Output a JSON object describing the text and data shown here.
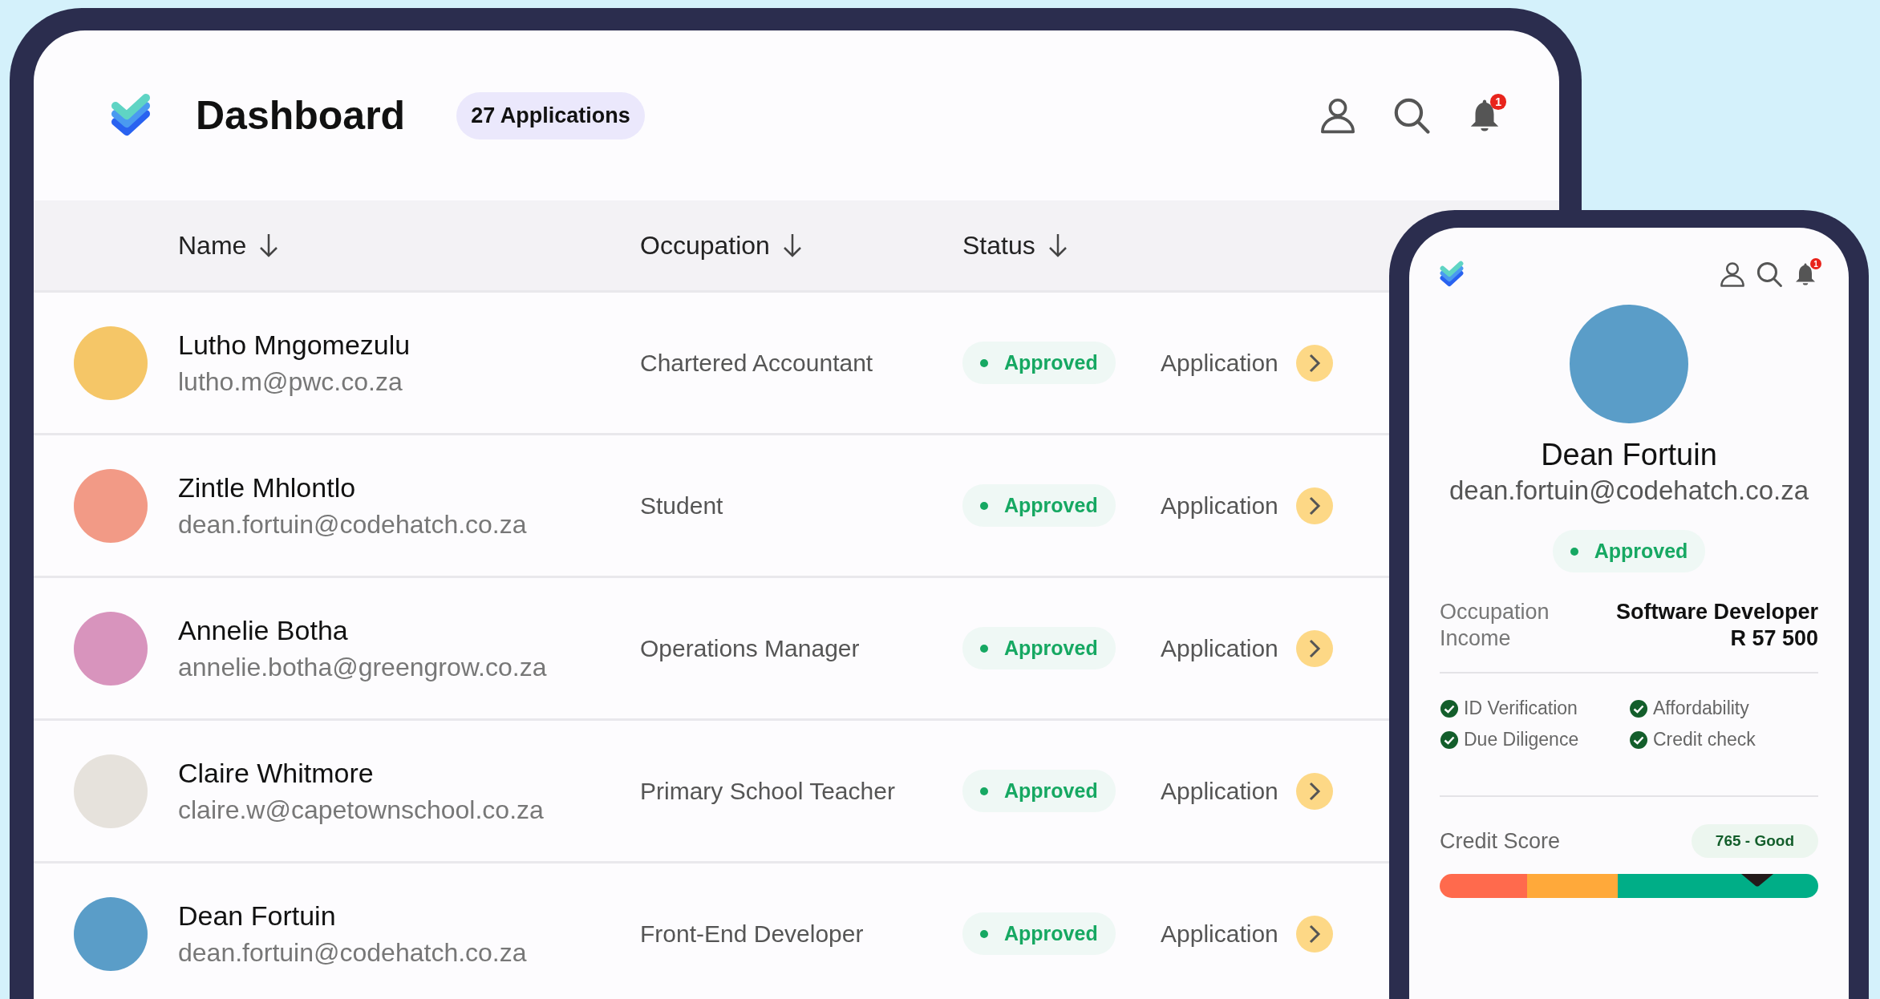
{
  "header": {
    "title": "Dashboard",
    "count_badge": "27 Applications",
    "notification_count": "1"
  },
  "table": {
    "columns": [
      {
        "label": "Name"
      },
      {
        "label": "Occupation"
      },
      {
        "label": "Status"
      }
    ],
    "rows": [
      {
        "name": "Lutho Mngomezulu",
        "email": "lutho.m@pwc.co.za",
        "occupation": "Chartered Accountant",
        "status": "Approved",
        "action": "Application",
        "color": "#f5c667"
      },
      {
        "name": "Zintle Mhlontlo",
        "email": "dean.fortuin@codehatch.co.za",
        "occupation": "Student",
        "status": "Approved",
        "action": "Application",
        "color": "#f29a86"
      },
      {
        "name": "Annelie Botha",
        "email": "annelie.botha@greengrow.co.za",
        "occupation": "Operations Manager",
        "status": "Approved",
        "action": "Application",
        "color": "#d894bd"
      },
      {
        "name": "Claire Whitmore",
        "email": "claire.w@capetownschool.co.za",
        "occupation": "Primary School Teacher",
        "status": "Approved",
        "action": "Application",
        "color": "#e6e2dc"
      },
      {
        "name": "Dean Fortuin",
        "email": "dean.fortuin@codehatch.co.za",
        "occupation": "Front-End Developer",
        "status": "Approved",
        "action": "Application",
        "color": "#5a9dc8"
      }
    ]
  },
  "detail": {
    "notification_count": "1",
    "name": "Dean Fortuin",
    "email": "dean.fortuin@codehatch.co.za",
    "status": "Approved",
    "fields": [
      {
        "label": "Occupation",
        "value": "Software Developer"
      },
      {
        "label": "Income",
        "value": "R 57 500"
      }
    ],
    "checks": [
      {
        "label": "ID Verification",
        "checked": true
      },
      {
        "label": "Affordability",
        "checked": true
      },
      {
        "label": "Due Diligence",
        "checked": true
      },
      {
        "label": "Credit check",
        "checked": true
      }
    ],
    "credit": {
      "label": "Credit Score",
      "badge": "765 - Good",
      "level": 0.84
    }
  }
}
